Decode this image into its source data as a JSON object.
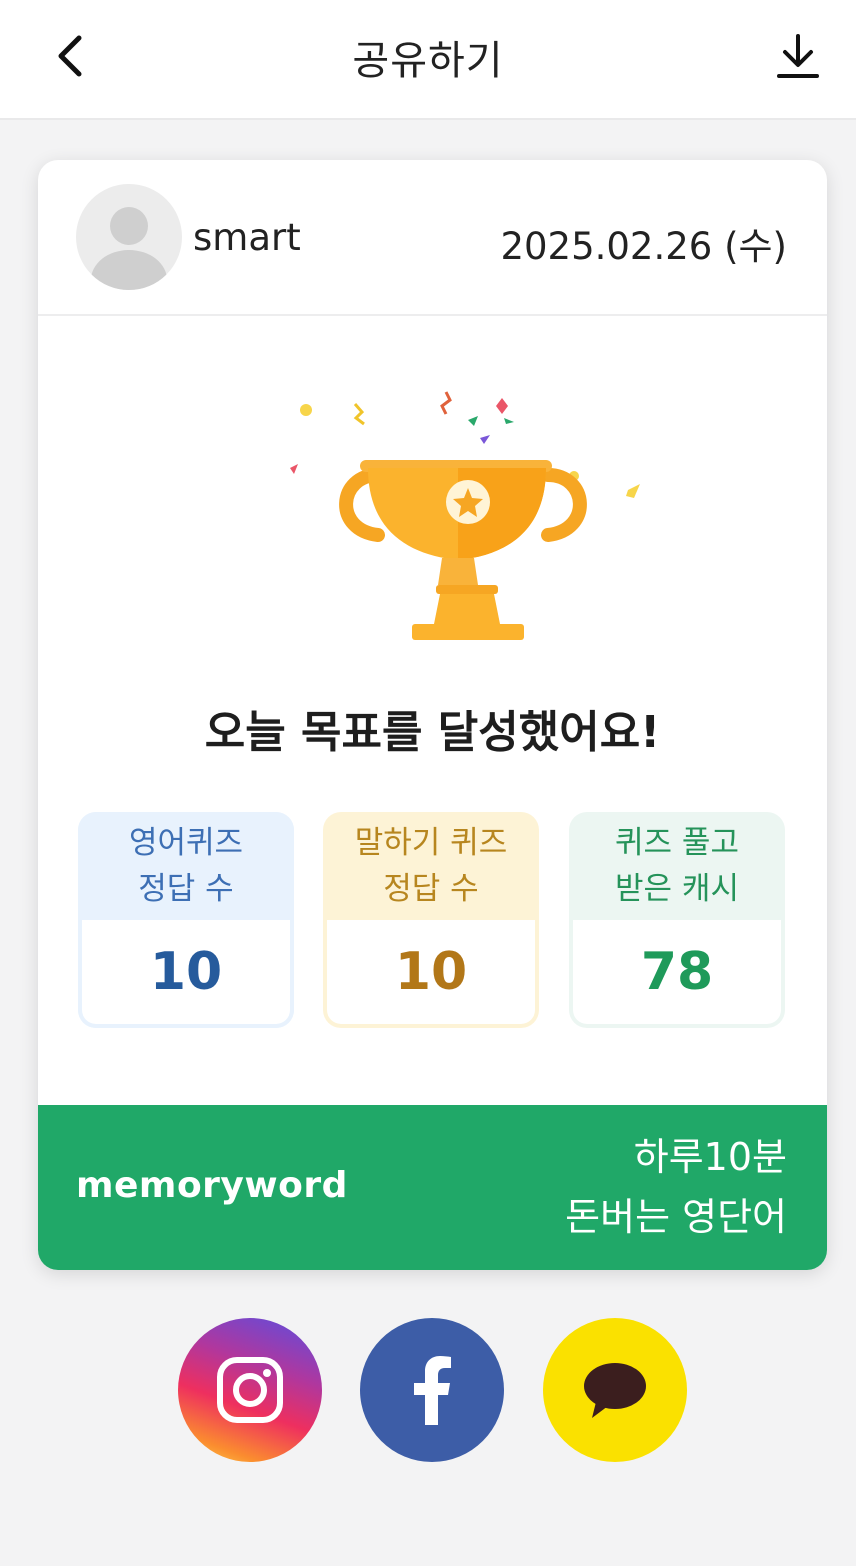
{
  "header": {
    "title": "공유하기"
  },
  "card": {
    "username": "smart",
    "date": "2025.02.26 (수)",
    "headline": "오늘 목표를 달성했어요!",
    "stats": [
      {
        "label_line1": "영어퀴즈",
        "label_line2": "정답 수",
        "value": "10"
      },
      {
        "label_line1": "말하기 퀴즈",
        "label_line2": "정답 수",
        "value": "10"
      },
      {
        "label_line1": "퀴즈 풀고",
        "label_line2": "받은 캐시",
        "value": "78"
      }
    ],
    "brand": {
      "name": "memoryword",
      "slogan_line1": "하루10분",
      "slogan_line2": "돈버는 영단어"
    }
  },
  "share": [
    {
      "name": "instagram",
      "icon": "instagram-icon",
      "color": "#e1306c"
    },
    {
      "name": "facebook",
      "icon": "facebook-icon",
      "color": "#3d5da7"
    },
    {
      "name": "kakaotalk",
      "icon": "kakaotalk-icon",
      "color": "#fae100"
    }
  ],
  "colors": {
    "brand_green": "#20a868",
    "background": "#f3f3f4",
    "trophy_gold": "#fbb32d"
  }
}
